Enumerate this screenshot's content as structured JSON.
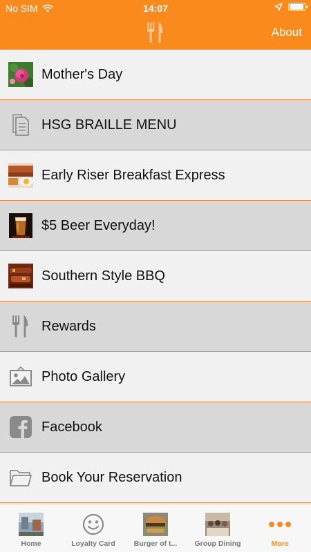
{
  "status_bar": {
    "carrier": "No SIM",
    "time": "14:07"
  },
  "header": {
    "logo_icon": "fork-knife-icon",
    "about_label": "About"
  },
  "menu_items": [
    {
      "label": "Mother's Day",
      "icon": "flowers-photo",
      "style": "light"
    },
    {
      "label": "HSG BRAILLE MENU",
      "icon": "document-icon",
      "style": "dark"
    },
    {
      "label": "Early Riser Breakfast Express",
      "icon": "breakfast-photo",
      "style": "light"
    },
    {
      "label": "$5 Beer Everyday!",
      "icon": "beer-photo",
      "style": "dark"
    },
    {
      "label": "Southern Style BBQ",
      "icon": "bbq-photo",
      "style": "light"
    },
    {
      "label": "Rewards",
      "icon": "fork-knife-icon",
      "style": "dark"
    },
    {
      "label": "Photo Gallery",
      "icon": "picture-icon",
      "style": "light"
    },
    {
      "label": "Facebook",
      "icon": "facebook-icon",
      "style": "dark"
    },
    {
      "label": "Book Your Reservation",
      "icon": "folder-icon",
      "style": "light"
    }
  ],
  "tabs": [
    {
      "label": "Home",
      "icon": "home-photo",
      "active": false
    },
    {
      "label": "Loyalty Card",
      "icon": "smiley-icon",
      "active": false
    },
    {
      "label": "Burger of t...",
      "icon": "burger-photo",
      "active": false
    },
    {
      "label": "Group Dining",
      "icon": "dining-photo",
      "active": false
    },
    {
      "label": "More",
      "icon": "more-dots-icon",
      "active": true
    }
  ],
  "colors": {
    "brand_orange": "#fb8a1d",
    "row_light": "#f1f1f1",
    "row_dark": "#d8d8d8",
    "row_divider": "#f08a3c"
  }
}
